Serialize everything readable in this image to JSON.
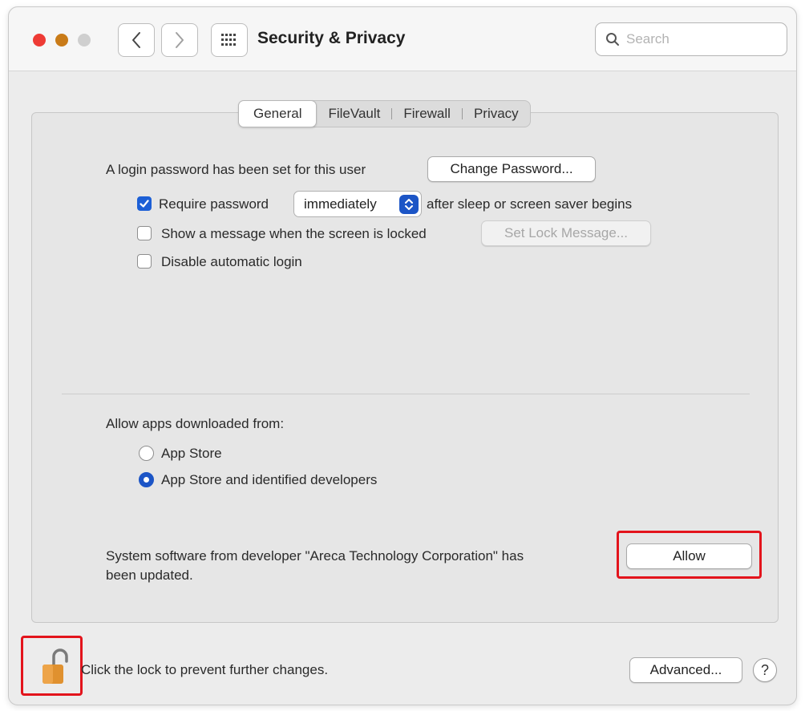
{
  "window": {
    "title": "Security & Privacy",
    "search_placeholder": "Search"
  },
  "tabs": [
    {
      "label": "General",
      "active": true
    },
    {
      "label": "FileVault",
      "active": false
    },
    {
      "label": "Firewall",
      "active": false
    },
    {
      "label": "Privacy",
      "active": false
    }
  ],
  "general": {
    "login_password_text": "A login password has been set for this user",
    "change_password_label": "Change Password...",
    "require_password": {
      "label": "Require password",
      "checked": true,
      "selected_option": "immediately",
      "suffix": "after sleep or screen saver begins"
    },
    "show_message": {
      "label": "Show a message when the screen is locked",
      "checked": false,
      "button_label": "Set Lock Message..."
    },
    "disable_auto_login": {
      "label": "Disable automatic login",
      "checked": false
    }
  },
  "allow_apps": {
    "heading": "Allow apps downloaded from:",
    "options": [
      {
        "label": "App Store",
        "selected": false
      },
      {
        "label": "App Store and identified developers",
        "selected": true
      }
    ]
  },
  "system_software": {
    "message_line1": "System software from developer \"Areca Technology Corporation\" has",
    "message_line2": "been updated.",
    "allow_label": "Allow"
  },
  "footer": {
    "lock_text": "Click the lock to prevent further changes.",
    "advanced_label": "Advanced...",
    "help_label": "?"
  },
  "colors": {
    "accent": "#1c55c6",
    "highlight": "#e3141c",
    "lock": "#e0912f"
  }
}
